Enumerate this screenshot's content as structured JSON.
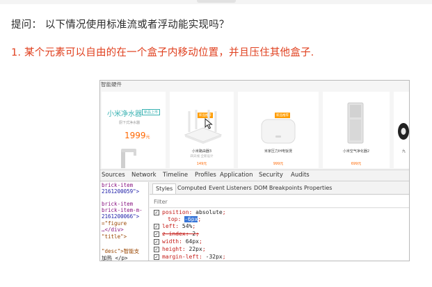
{
  "question": "提问： 以下情况使用标准流或者浮动能实现吗？",
  "point": "1. 某个元素可以自由的在一个盒子内移动位置，并且压住其他盒子.",
  "site": {
    "category": "智能硬件",
    "featured": {
      "name": "小米净水器",
      "badge": "新品上市",
      "desc": "厨下式净水器",
      "price": "1999",
      "unit": "元"
    },
    "products": [
      {
        "name": "小米路由器3",
        "desc": "四天线 全新设计",
        "price": "149元",
        "tag": "新品推荐"
      },
      {
        "name": "米家压力IH电饭煲",
        "desc": "",
        "price": "999元",
        "tag": "新品推荐"
      },
      {
        "name": "小米空气净化器2",
        "desc": "",
        "price": "699元",
        "tag": ""
      },
      {
        "name": "九",
        "desc": "",
        "price": "",
        "tag": ""
      }
    ]
  },
  "devtools": {
    "main_tabs": [
      "Sources",
      "Network",
      "Timeline",
      "Profiles",
      "Application",
      "Security",
      "Audits"
    ],
    "dom_lines": [
      "brick-item",
      "2161200059\">",
      "",
      "brick-item",
      "brick-item-m-",
      "2161200066\">",
      "=\"figure",
      "…</div>",
      "\"title\">",
      "",
      "\"desc\">智能支",
      "加热 </p>"
    ],
    "sub_tabs": [
      "Styles",
      "Computed",
      "Event Listeners",
      "DOM Breakpoints",
      "Properties"
    ],
    "active_sub_tab": "Styles",
    "filter_placeholder": "Filter",
    "css_rules": [
      {
        "prop": "position",
        "value": "absolute",
        "checked": true,
        "struck": false
      },
      {
        "prop": "top",
        "value": "-6px",
        "checked": true,
        "struck": false
      },
      {
        "prop": "left",
        "value": "54%",
        "checked": true,
        "struck": false
      },
      {
        "prop": "z-index",
        "value": "2",
        "checked": true,
        "struck": true
      },
      {
        "prop": "width",
        "value": "64px",
        "checked": true,
        "struck": false
      },
      {
        "prop": "height",
        "value": "22px",
        "checked": true,
        "struck": false
      },
      {
        "prop": "margin-left",
        "value": "-32px",
        "checked": true,
        "struck": false
      }
    ]
  }
}
